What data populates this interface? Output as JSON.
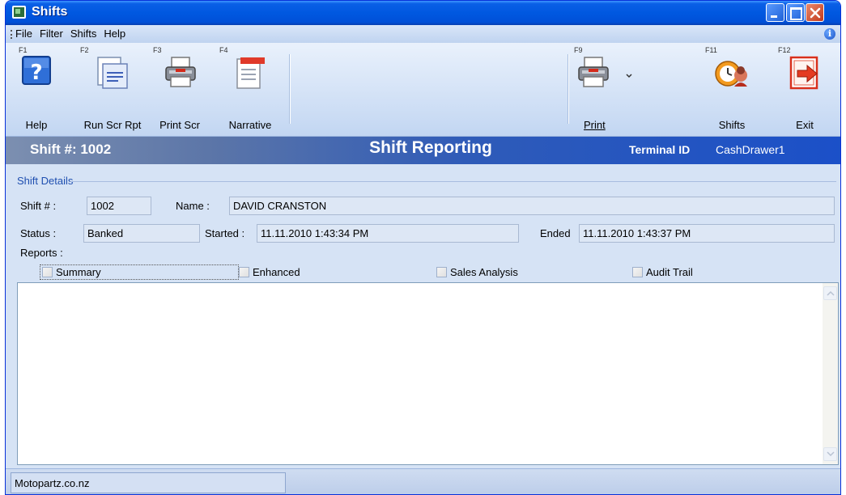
{
  "window": {
    "title": "Shifts"
  },
  "menu": {
    "items": [
      "File",
      "Filter",
      "Shifts",
      "Help"
    ]
  },
  "toolbar": {
    "help": {
      "fkey": "F1",
      "label": "Help"
    },
    "run_scr_rpt": {
      "fkey": "F2",
      "label": "Run Scr Rpt"
    },
    "print_scr": {
      "fkey": "F3",
      "label": "Print Scr"
    },
    "narrative": {
      "fkey": "F4",
      "label": "Narrative"
    },
    "print": {
      "fkey": "F9",
      "label": "Print"
    },
    "shifts": {
      "fkey": "F11",
      "label": "Shifts"
    },
    "exit": {
      "fkey": "F12",
      "label": "Exit"
    }
  },
  "header": {
    "shift_no": "Shift #: 1002",
    "title": "Shift Reporting",
    "terminal_label": "Terminal ID",
    "terminal_value": "CashDrawer1"
  },
  "details": {
    "group_title": "Shift Details",
    "shift_label": "Shift # :",
    "shift_value": "1002",
    "name_label": "Name :",
    "name_value": "DAVID CRANSTON",
    "status_label": "Status :",
    "status_value": "Banked",
    "started_label": "Started :",
    "started_value": "11.11.2010 1:43:34 PM",
    "ended_label": "Ended",
    "ended_value": "11.11.2010 1:43:37 PM",
    "reports_label": "Reports :",
    "reports": [
      {
        "label": "Summary",
        "checked": false
      },
      {
        "label": "Enhanced",
        "checked": false
      },
      {
        "label": "Sales Analysis",
        "checked": false
      },
      {
        "label": "Audit Trail",
        "checked": false
      }
    ]
  },
  "status_bar": {
    "text": "Motopartz.co.nz"
  },
  "colors": {
    "titlebar": "#0058e0",
    "band_right": "#1b50c8",
    "group_title": "#1f4fb0"
  }
}
